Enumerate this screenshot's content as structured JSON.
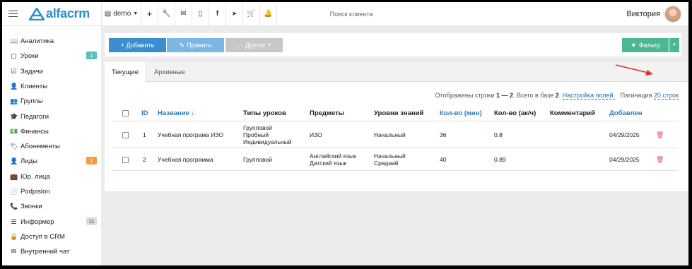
{
  "topbar": {
    "brand": "alfacrm",
    "branch": "demo",
    "icons": [
      "plus-icon",
      "wrench-icon",
      "mail-icon",
      "phone-icon",
      "facebook-icon",
      "telegram-icon",
      "cart-icon",
      "bell-icon"
    ],
    "search_placeholder": "Поиск клиента",
    "user_name": "Виктория"
  },
  "sidebar": {
    "items": [
      {
        "label": "Аналитика",
        "icon": "chart-icon",
        "glyph": "📖",
        "badge": ""
      },
      {
        "label": "Уроки",
        "icon": "calendar-icon",
        "glyph": "▢",
        "badge": "1",
        "badge_color": "#5bc0be"
      },
      {
        "label": "Задачи",
        "icon": "task-icon",
        "glyph": "☑",
        "badge": ""
      },
      {
        "label": "Клиенты",
        "icon": "user-icon",
        "glyph": "👤",
        "badge": ""
      },
      {
        "label": "Группы",
        "icon": "group-icon",
        "glyph": "👥",
        "badge": ""
      },
      {
        "label": "Педагоги",
        "icon": "graduation-icon",
        "glyph": "🎓",
        "badge": ""
      },
      {
        "label": "Финансы",
        "icon": "money-icon",
        "glyph": "💵",
        "badge": ""
      },
      {
        "label": "Абонементы",
        "icon": "tag-icon",
        "glyph": "🏷",
        "badge": ""
      },
      {
        "label": "Лиды",
        "icon": "user-plus-icon",
        "glyph": "👤",
        "badge": "1",
        "badge_color": "#f0a040"
      },
      {
        "label": "Юр. лица",
        "icon": "briefcase-icon",
        "glyph": "💼",
        "badge": ""
      },
      {
        "label": "Podpislon",
        "icon": "document-icon",
        "glyph": "📄",
        "badge": ""
      },
      {
        "label": "Звонки",
        "icon": "phone-icon",
        "glyph": "📞",
        "badge": ""
      },
      {
        "label": "Информер",
        "icon": "server-icon",
        "glyph": "☰",
        "badge": "11",
        "badge_color": "#d5dbe0"
      },
      {
        "label": "Доступ в CRM",
        "icon": "lock-icon",
        "glyph": "🔒",
        "badge": ""
      },
      {
        "label": "Внутренний чат",
        "icon": "envelope-icon",
        "glyph": "✉",
        "badge": ""
      }
    ]
  },
  "toolbar": {
    "add_label": "+ Добавить",
    "edit_label": "Править",
    "other_label": "Другое",
    "filter_label": "Фильтр"
  },
  "tabs": [
    "Текущие",
    "Архивные"
  ],
  "info": {
    "text": "Отображены строки",
    "range": "1 — 2",
    "total_text": ". Всего в базе",
    "total": "2",
    "settings_link": "Настройка полей.",
    "pagination_label": "Пагинация",
    "pagination_value": "20 строк"
  },
  "table": {
    "headers": [
      "ID",
      "Название ↓",
      "Типы уроков",
      "Предметы",
      "Уровни знаний",
      "Кол-во (мин)",
      "Кол-во (ак/ч)",
      "Комментарий",
      "Добавлен"
    ],
    "rows": [
      {
        "id": "1",
        "name": "Учебная програма ИЗО",
        "types": [
          "Групповой",
          "Пробный",
          "Индивидуальный"
        ],
        "subjects": [
          "ИЗО"
        ],
        "levels": [
          "Начальный"
        ],
        "minutes": "36",
        "hours": "0.8",
        "comment": "",
        "added": "04/29/2025"
      },
      {
        "id": "2",
        "name": "Учебная программа",
        "types": [
          "Групповой"
        ],
        "subjects": [
          "Английский язык",
          "Датский язык"
        ],
        "levels": [
          "Начальный",
          "Средний"
        ],
        "minutes": "40",
        "hours": "0.89",
        "comment": "",
        "added": "04/29/2025"
      }
    ]
  },
  "colors": {
    "brand": "#2a8fc8",
    "add": "#3b8fcf",
    "filter": "#4cb891",
    "delete": "#e0525c",
    "annotation_arrow": "#e0302a"
  }
}
